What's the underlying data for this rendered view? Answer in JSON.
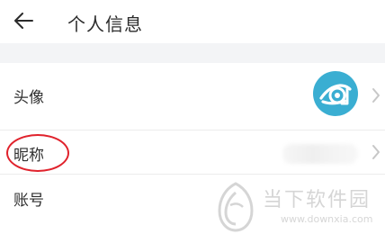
{
  "header": {
    "back_icon": "arrow-left-icon",
    "title": "个人信息"
  },
  "rows": [
    {
      "label": "头像",
      "value_type": "avatar",
      "chevron_icon": "chevron-right-icon"
    },
    {
      "label": "昵称",
      "value_type": "blurred-text",
      "chevron_icon": "chevron-right-icon"
    },
    {
      "label": "账号",
      "value_type": "blank"
    }
  ],
  "annotation": {
    "type": "red-circle",
    "target": "昵称",
    "color": "#e0222c"
  },
  "avatar": {
    "background_color": "#3aaed2",
    "icon": "stylized-eye-icon"
  },
  "watermark": {
    "brand_text": "当下软件园",
    "url_text": "www.downxia.com",
    "logo_icon": "downxia-logo-icon"
  },
  "colors": {
    "page_background": "#f5f5f5",
    "row_background": "#ffffff",
    "title_text": "#2b2b2b",
    "label_text": "#303030",
    "annotation_red": "#e0222c"
  }
}
